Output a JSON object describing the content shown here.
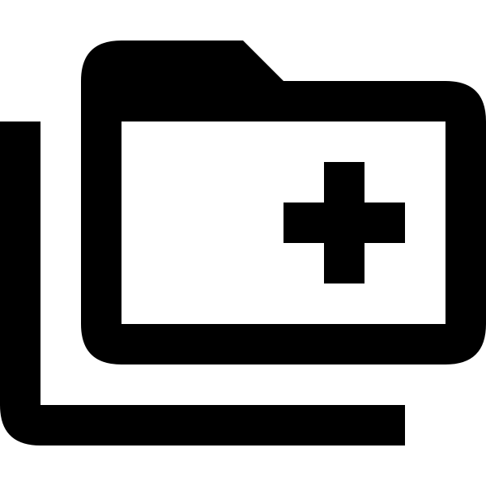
{
  "icon": {
    "name": "create-new-folder-stacked-icon",
    "fill_color": "#000000",
    "background_color": "#ffffff"
  }
}
